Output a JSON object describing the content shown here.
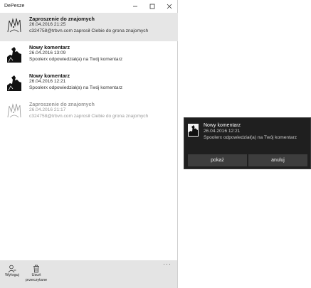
{
  "window": {
    "title": "DePesze",
    "controls": [
      "minimize-icon",
      "maximize-icon",
      "close-icon"
    ]
  },
  "notifications": [
    {
      "title": "Zaproszenie do znajomych",
      "date": "26.04.2016 21:25",
      "message": "c324758@trbvn.com zaprosił Ciebie do grona znajomych",
      "icon": "avatar-sketch-icon",
      "state": "selected"
    },
    {
      "title": "Nowy komentarz",
      "date": "26.04.2016 13:09",
      "message": "Spoolerx odpowiedział(a) na Twój komentarz",
      "icon": "avatar-silhouette-icon",
      "state": "unread"
    },
    {
      "title": "Nowy komentarz",
      "date": "26.04.2016 12:21",
      "message": "Spoolerx odpowiedział(a) na Twój komentarz",
      "icon": "avatar-silhouette-icon",
      "state": "unread"
    },
    {
      "title": "Zaproszenie do znajomych",
      "date": "26.04.2016 21:17",
      "message": "c324758@trbvn.com zaprosił Ciebie do grona znajomych",
      "icon": "avatar-sketch-icon",
      "state": "read"
    }
  ],
  "commandbar": {
    "logout_label": "Wyloguj",
    "delete_label_1": "Usuń",
    "delete_label_2": "przeczytane",
    "more": "···"
  },
  "toast": {
    "title": "Nowy komentarz",
    "date": "26.04.2016 12:21",
    "message": "Spoolerx odpowiedział(a) na Twój komentarz",
    "show_label": "pokaż",
    "cancel_label": "anuluj"
  },
  "colors": {
    "selected_bg": "#e6e6e6",
    "commandbar_bg": "#e4e4e4",
    "toast_bg": "#1f1f1f",
    "toast_button_bg": "#3d3d3d",
    "read_text": "#9a9a9a"
  }
}
